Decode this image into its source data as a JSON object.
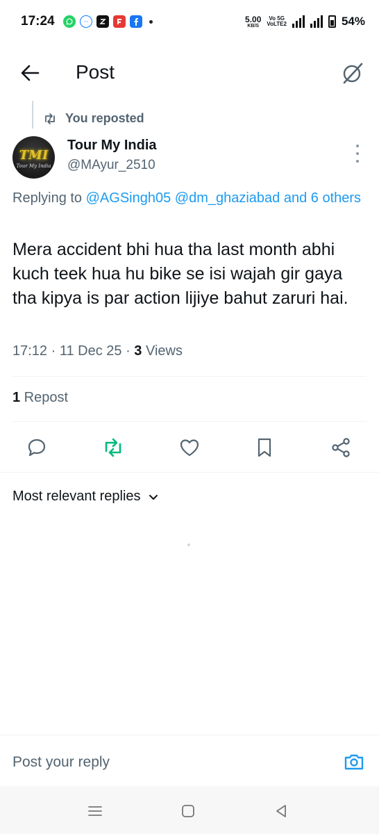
{
  "status_bar": {
    "time": "17:24",
    "speed_value": "5.00",
    "speed_unit": "KB/S",
    "net_top": "Vo 5G",
    "net_bottom": "VoLTE2",
    "battery": "54%",
    "apps": [
      "whatsapp-icon",
      "messenger-icon",
      "zomato-icon",
      "flipboard-icon",
      "facebook-icon"
    ]
  },
  "header": {
    "title": "Post"
  },
  "post": {
    "repost_label": "You reposted",
    "author_name": "Tour My India",
    "author_handle": "@MAyur_2510",
    "avatar_monogram": "TMI",
    "avatar_caption": "Tour My India",
    "replying_prefix": "Replying to",
    "replying_users": "@AGSingh05 @dm_ghaziabad and 6 others",
    "text": "Mera accident bhi hua tha last month abhi kuch teek hua hu bike se isi wajah gir gaya tha kipya is par action lijiye bahut zaruri hai.",
    "timestamp": "17:12 · 11 Dec 25 · ",
    "views_count": "3",
    "views_label": " Views",
    "repost_count": "1",
    "repost_count_label": " Repost"
  },
  "replies": {
    "sort_label": "Most relevant replies"
  },
  "composer": {
    "placeholder": "Post your reply"
  },
  "colors": {
    "accent": "#1d9bf0",
    "repost_green": "#00ba7c",
    "secondary_text": "#536471",
    "primary_text": "#0f1419"
  }
}
